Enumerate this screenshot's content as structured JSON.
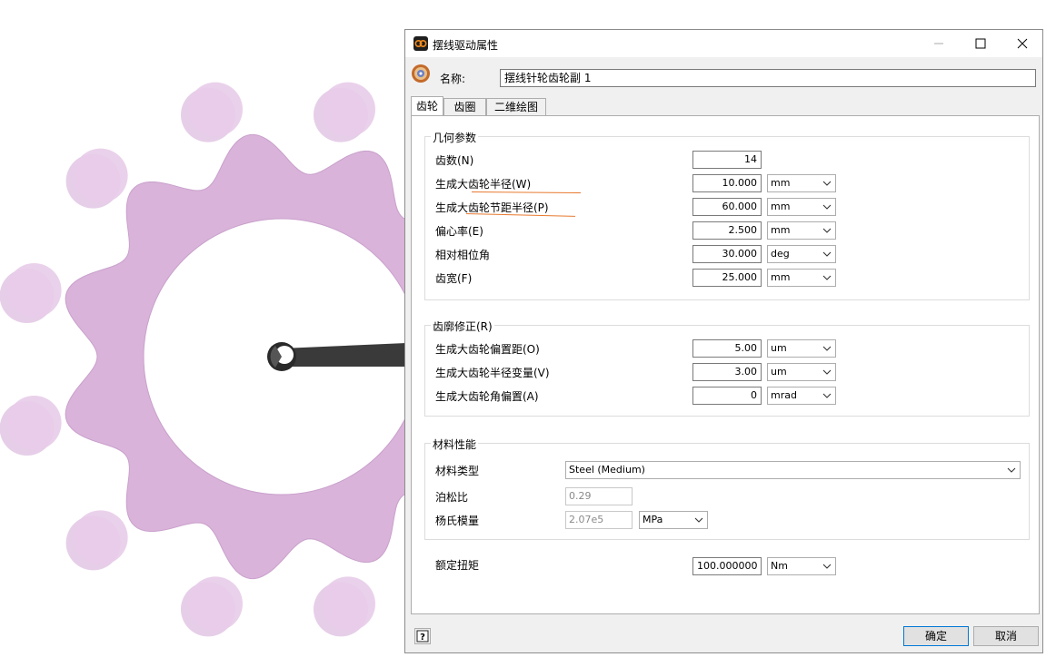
{
  "window": {
    "title": "摆线驱动属性"
  },
  "name_field": {
    "label": "名称:",
    "value": "摆线针轮齿轮副 1"
  },
  "tabs": [
    {
      "label": "齿轮",
      "active": true
    },
    {
      "label": "齿圈",
      "active": false
    },
    {
      "label": "二维绘图",
      "active": false
    }
  ],
  "geometry": {
    "title": "几何参数",
    "rows": [
      {
        "label": "齿数(N)",
        "value": "14",
        "unit": null
      },
      {
        "label": "生成大齿轮半径(W)",
        "value": "10.000",
        "unit": "mm"
      },
      {
        "label": "生成大齿轮节距半径(P)",
        "value": "60.000",
        "unit": "mm"
      },
      {
        "label": "偏心率(E)",
        "value": "2.500",
        "unit": "mm"
      },
      {
        "label": "相对相位角",
        "value": "30.000",
        "unit": "deg"
      },
      {
        "label": "齿宽(F)",
        "value": "25.000",
        "unit": "mm"
      }
    ]
  },
  "profile_mod": {
    "title": "齿廓修正(R)",
    "rows": [
      {
        "label": "生成大齿轮偏置距(O)",
        "value": "5.00",
        "unit": "um"
      },
      {
        "label": "生成大齿轮半径变量(V)",
        "value": "3.00",
        "unit": "um"
      },
      {
        "label": "生成大齿轮角偏置(A)",
        "value": "0",
        "unit": "mrad"
      }
    ]
  },
  "material": {
    "title": "材料性能",
    "type_label": "材料类型",
    "type_value": "Steel (Medium)",
    "poisson_label": "泊松比",
    "poisson_value": "0.29",
    "young_label": "杨氏模量",
    "young_value": "2.07e5",
    "young_unit": "MPa"
  },
  "torque": {
    "label": "额定扭矩",
    "value": "100.000000",
    "unit": "Nm"
  },
  "buttons": {
    "ok": "确定",
    "cancel": "取消"
  },
  "colors": {
    "gear": "#d9b3d9",
    "pin": "#e2c5e4",
    "accent": "#e8792e",
    "focus": "#0078d7"
  }
}
